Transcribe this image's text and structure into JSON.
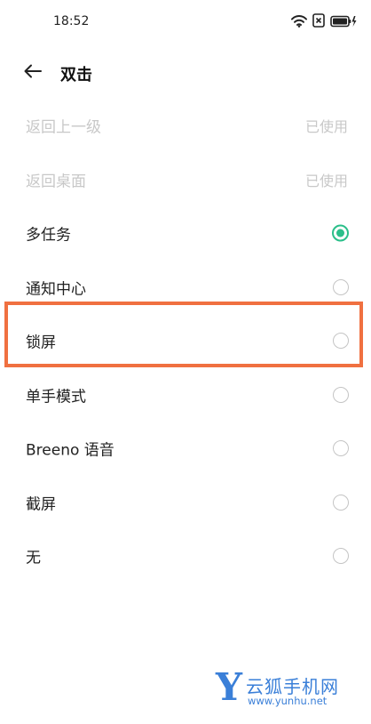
{
  "status_bar": {
    "time": "18:52",
    "icons": [
      "wifi-icon",
      "sim-x-icon",
      "battery-charging-icon"
    ]
  },
  "header": {
    "back_icon": "arrow-left-icon",
    "title": "双击"
  },
  "options": [
    {
      "label": "返回上一级",
      "state": "disabled",
      "status": "已使用"
    },
    {
      "label": "返回桌面",
      "state": "disabled",
      "status": "已使用"
    },
    {
      "label": "多任务",
      "state": "checked"
    },
    {
      "label": "通知中心",
      "state": "unchecked"
    },
    {
      "label": "锁屏",
      "state": "unchecked",
      "highlighted": true
    },
    {
      "label": "单手模式",
      "state": "unchecked"
    },
    {
      "label": "Breeno 语音",
      "state": "unchecked"
    },
    {
      "label": "截屏",
      "state": "unchecked"
    },
    {
      "label": "无",
      "state": "unchecked"
    }
  ],
  "colors": {
    "accent": "#2bbf8a",
    "highlight": "#f07040",
    "watermark": "#3a7fd8",
    "disabled_text": "#c8c8c8"
  },
  "watermark": {
    "logo": "Y",
    "name": "云狐手机网",
    "url": "www.yunhu.net"
  }
}
